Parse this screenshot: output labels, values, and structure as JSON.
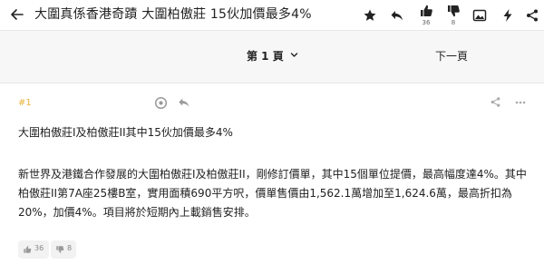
{
  "topbar": {
    "title": "大圍真係香港奇蹟 大圍柏傲莊 15伙加價最多4%",
    "like_count": "36",
    "dislike_count": "8"
  },
  "pagebar": {
    "current_page": "第 1 頁",
    "next_page": "下一頁"
  },
  "post": {
    "floor": "#1",
    "line1": "大圍柏傲莊I及柏傲莊II其中15伙加價最多4%",
    "paragraph2": "新世界及港鐵合作發展的大圍柏傲莊I及柏傲莊II，剛修訂價單，其中15個單位提價，最高幅度達4%。其中柏傲莊II第7A座25樓B室，實用面積690平方呎，價單售價由1,562.1萬增加至1,624.6萬，最高折扣為20%，加價4%。項目將於短期內上載銷售安排。",
    "upvotes": "36",
    "downvotes": "8"
  },
  "colors": {
    "floor_accent": "#e8b33a",
    "text": "#222222",
    "muted": "#888888"
  },
  "icons": [
    "back-arrow-icon",
    "star-icon",
    "reply-icon",
    "thumb-up-icon",
    "thumb-down-icon",
    "image-icon",
    "lightning-icon",
    "share-icon",
    "eye-icon",
    "more-icon"
  ]
}
